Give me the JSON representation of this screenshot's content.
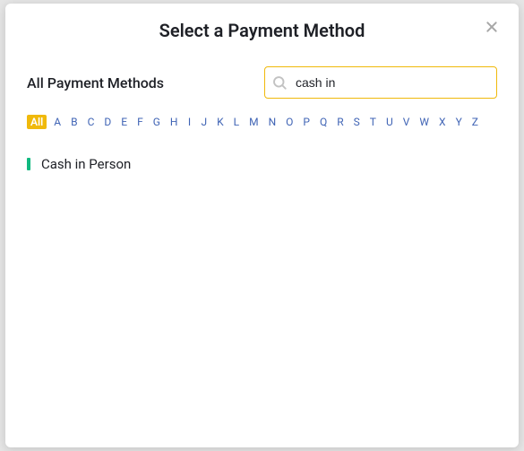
{
  "modal": {
    "title": "Select a Payment Method",
    "subtitle": "All Payment Methods"
  },
  "search": {
    "value": "cash in",
    "placeholder": ""
  },
  "alphaFilter": {
    "active": "All",
    "items": [
      "All",
      "A",
      "B",
      "C",
      "D",
      "E",
      "F",
      "G",
      "H",
      "I",
      "J",
      "K",
      "L",
      "M",
      "N",
      "O",
      "P",
      "Q",
      "R",
      "S",
      "T",
      "U",
      "V",
      "W",
      "X",
      "Y",
      "Z"
    ]
  },
  "results": [
    {
      "label": "Cash in Person",
      "accent": "#11b980"
    }
  ]
}
